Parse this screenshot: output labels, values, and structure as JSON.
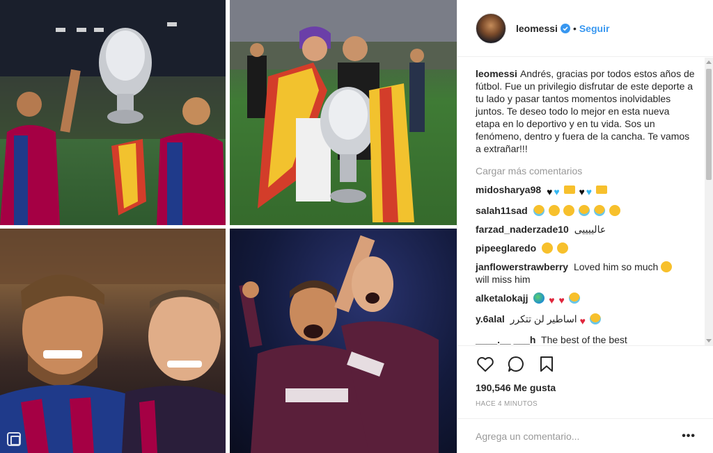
{
  "colors": {
    "follow_blue": "#3897f0",
    "verified_blue": "#3897f0",
    "text_primary": "#262626",
    "text_secondary": "#999999",
    "barca_blue": "#1f3a8a",
    "barca_red": "#a50044"
  },
  "post": {
    "author": "leomessi",
    "follow_label": "Seguir",
    "dot": "•",
    "caption_user": "leomessi",
    "caption": "Andrés, gracias por todos estos años de fútbol. Fue un privilegio disfrutar de este deporte a tu lado y pasar tantos momentos inolvidables juntos. Te deseo todo lo mejor en esta nueva etapa en lo deportivo y en tu vida. Sos un fenómeno, dentro y fuera de la cancha. Te vamos a extrañar!!!",
    "load_more": "Cargar más comentarios",
    "likes": "190,546 Me gusta",
    "time_ago": "HACE 4 MINUTOS",
    "add_comment_placeholder": "Agrega un comentario...",
    "more_options": "•••"
  },
  "comments": [
    {
      "user": "midosharya98",
      "text": ""
    },
    {
      "user": "salah11sad",
      "text": ""
    },
    {
      "user": "farzad_naderzade10",
      "text": "عالييييى"
    },
    {
      "user": "pipeeglaredo",
      "text": ""
    },
    {
      "user": "janflowerstrawberry",
      "text": "Loved him so much",
      "text2": "will miss him"
    },
    {
      "user": "alketalokajj",
      "text": ""
    },
    {
      "user": "y.6alal",
      "text": "اساطير لن تتكرر"
    },
    {
      "user": "____.__ ___h",
      "text": "The best of the best"
    }
  ],
  "icons": {
    "verified": "verified-badge-icon",
    "like": "heart-outline-icon",
    "comment": "speech-bubble-icon",
    "save": "bookmark-icon",
    "multi": "multi-photo-icon"
  }
}
